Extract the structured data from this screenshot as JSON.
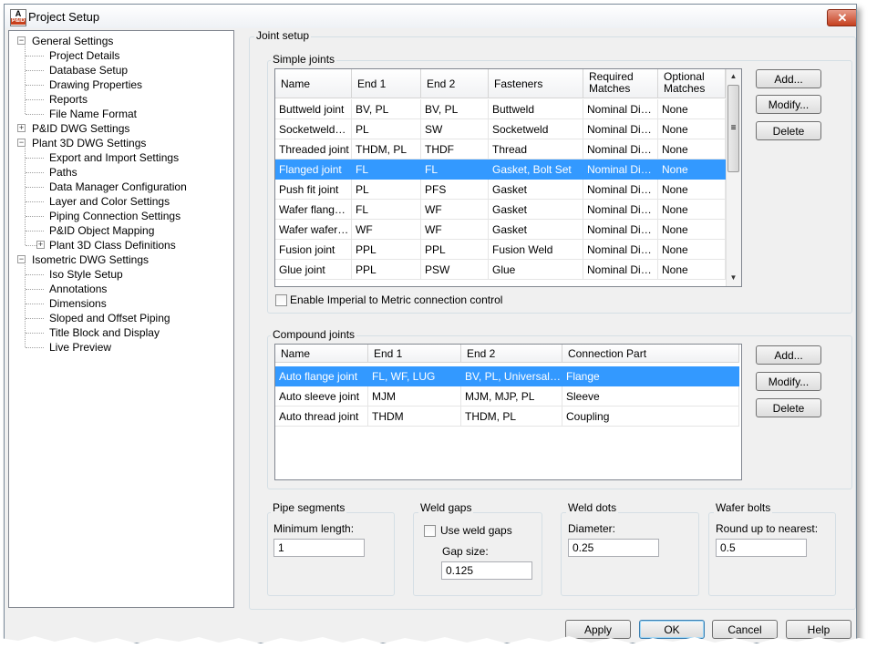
{
  "window": {
    "title": "Project Setup",
    "close_glyph": "✕",
    "icon_top": "A",
    "icon_sub": "P&ID"
  },
  "tree": [
    {
      "label": "General Settings",
      "level": 0,
      "expander": "⊟"
    },
    {
      "label": "Project Details",
      "level": 1
    },
    {
      "label": "Database Setup",
      "level": 1
    },
    {
      "label": "Drawing Properties",
      "level": 1
    },
    {
      "label": "Reports",
      "level": 1
    },
    {
      "label": "File Name Format",
      "level": 1
    },
    {
      "label": "P&ID DWG Settings",
      "level": 0,
      "expander": "⊞"
    },
    {
      "label": "Plant 3D DWG Settings",
      "level": 0,
      "expander": "⊟"
    },
    {
      "label": "Export and Import Settings",
      "level": 1
    },
    {
      "label": "Paths",
      "level": 1
    },
    {
      "label": "Data Manager Configuration",
      "level": 1
    },
    {
      "label": "Layer and Color Settings",
      "level": 1
    },
    {
      "label": "Piping Connection Settings",
      "level": 1
    },
    {
      "label": "P&ID Object Mapping",
      "level": 1
    },
    {
      "label": "Plant 3D Class Definitions",
      "level": 1,
      "expander": "⊞"
    },
    {
      "label": "Isometric DWG Settings",
      "level": 0,
      "expander": "⊟"
    },
    {
      "label": "Iso Style Setup",
      "level": 1
    },
    {
      "label": "Annotations",
      "level": 1
    },
    {
      "label": "Dimensions",
      "level": 1
    },
    {
      "label": "Sloped and Offset Piping",
      "level": 1
    },
    {
      "label": "Title Block and Display",
      "level": 1
    },
    {
      "label": "Live Preview",
      "level": 1
    }
  ],
  "joint_setup": {
    "title": "Joint setup",
    "simple": {
      "title": "Simple joints",
      "columns": [
        "Name",
        "End 1",
        "End 2",
        "Fasteners",
        "Required Matches",
        "Optional Matches"
      ],
      "rows": [
        [
          "Buttweld joint",
          "BV, PL",
          "BV, PL",
          "Buttweld",
          "Nominal Diam...",
          "None"
        ],
        [
          "Socketwelded...",
          "PL",
          "SW",
          "Socketweld",
          "Nominal Diam...",
          "None"
        ],
        [
          "Threaded joint",
          "THDM, PL",
          "THDF",
          "Thread",
          "Nominal Diam...",
          "None"
        ],
        [
          "Flanged joint",
          "FL",
          "FL",
          "Gasket, Bolt Set",
          "Nominal Diam...",
          "None"
        ],
        [
          "Push fit joint",
          "PL",
          "PFS",
          "Gasket",
          "Nominal Diam...",
          "None"
        ],
        [
          "Wafer flanged...",
          "FL",
          "WF",
          "Gasket",
          "Nominal Diam...",
          "None"
        ],
        [
          "Wafer wafer j...",
          "WF",
          "WF",
          "Gasket",
          "Nominal Diam...",
          "None"
        ],
        [
          "Fusion joint",
          "PPL",
          "PPL",
          "Fusion Weld",
          "Nominal Diam...",
          "None"
        ],
        [
          "Glue joint",
          "PPL",
          "PSW",
          "Glue",
          "Nominal Diam...",
          "None"
        ]
      ],
      "selected_row": 3,
      "scroll_up": "▲",
      "scroll_down": "▼",
      "scroll_grip": "≡",
      "add": "Add...",
      "modify": "Modify...",
      "delete": "Delete",
      "imperial_checkbox": "Enable Imperial to Metric connection control"
    },
    "compound": {
      "title": "Compound joints",
      "columns": [
        "Name",
        "End 1",
        "End 2",
        "Connection Part"
      ],
      "rows": [
        [
          "Auto flange joint",
          "FL, WF, LUG",
          "BV, PL, Universal_ET",
          "Flange"
        ],
        [
          "Auto sleeve joint",
          "MJM",
          "MJM, MJP, PL",
          "Sleeve"
        ],
        [
          "Auto thread joint",
          "THDM",
          "THDM, PL",
          "Coupling"
        ]
      ],
      "selected_row": 0,
      "add": "Add...",
      "modify": "Modify...",
      "delete": "Delete"
    },
    "pipe_segments": {
      "title": "Pipe segments",
      "label": "Minimum length:",
      "value": "1"
    },
    "weld_gaps": {
      "title": "Weld gaps",
      "checkbox": "Use weld gaps",
      "label": "Gap size:",
      "value": "0.125"
    },
    "weld_dots": {
      "title": "Weld dots",
      "label": "Diameter:",
      "value": "0.25"
    },
    "wafer_bolts": {
      "title": "Wafer bolts",
      "label": "Round up to nearest:",
      "value": "0.5"
    }
  },
  "footer": {
    "apply": "Apply",
    "ok": "OK",
    "cancel": "Cancel",
    "help": "Help"
  }
}
